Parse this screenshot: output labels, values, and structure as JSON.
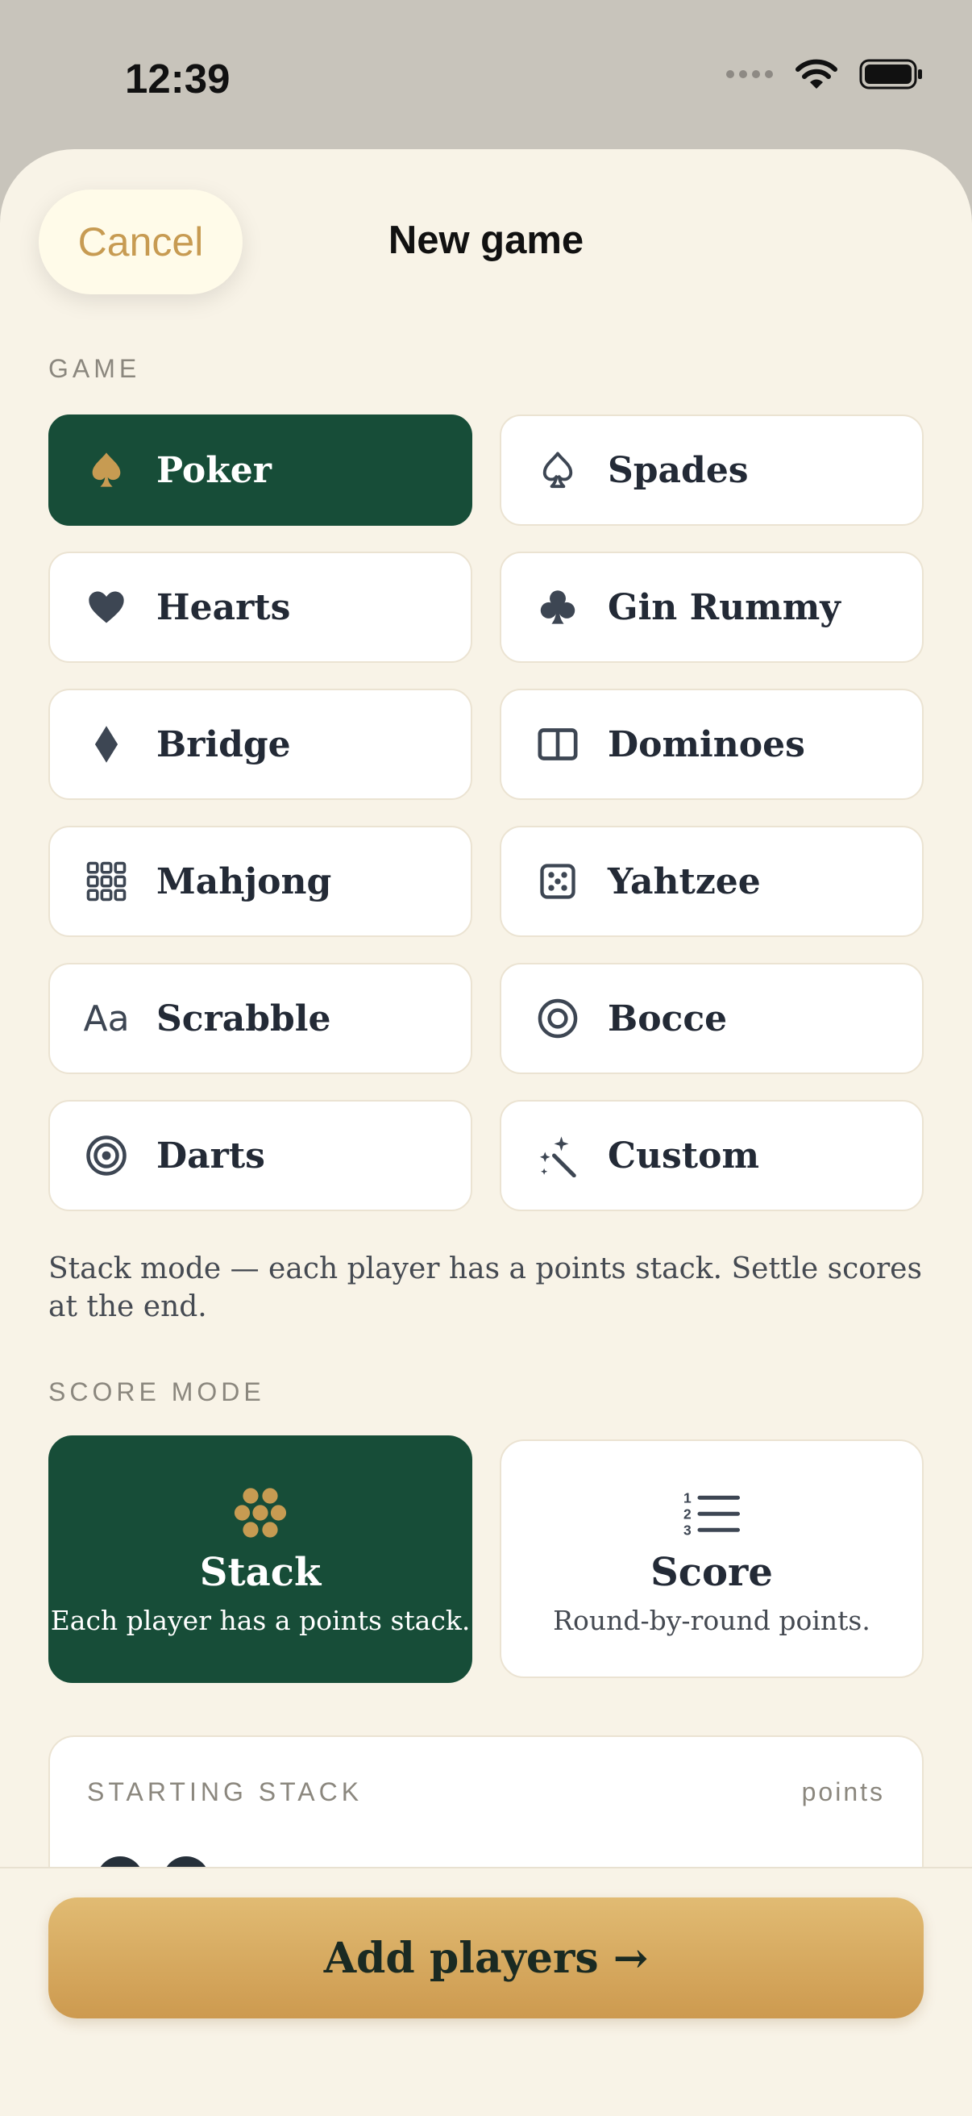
{
  "status": {
    "time": "12:39"
  },
  "header": {
    "cancel_label": "Cancel",
    "title": "New game"
  },
  "game_section": {
    "label": "GAME"
  },
  "games": [
    {
      "label": "Poker",
      "icon": "spade-icon",
      "selected": true
    },
    {
      "label": "Spades",
      "icon": "spade-outline-icon",
      "selected": false
    },
    {
      "label": "Hearts",
      "icon": "heart-icon",
      "selected": false
    },
    {
      "label": "Gin Rummy",
      "icon": "club-icon",
      "selected": false
    },
    {
      "label": "Bridge",
      "icon": "diamond-icon",
      "selected": false
    },
    {
      "label": "Dominoes",
      "icon": "domino-icon",
      "selected": false
    },
    {
      "label": "Mahjong",
      "icon": "grid-icon",
      "selected": false
    },
    {
      "label": "Yahtzee",
      "icon": "dice-icon",
      "selected": false
    },
    {
      "label": "Scrabble",
      "icon": "text-aa-icon",
      "selected": false
    },
    {
      "label": "Bocce",
      "icon": "ring-icon",
      "selected": false
    },
    {
      "label": "Darts",
      "icon": "target-icon",
      "selected": false
    },
    {
      "label": "Custom",
      "icon": "magic-wand-icon",
      "selected": false
    }
  ],
  "game_description": "Stack mode — each player has a points stack. Settle scores at the end.",
  "score_mode": {
    "label": "SCORE MODE",
    "options": [
      {
        "title": "Stack",
        "subtitle": "Each player has a points stack.",
        "icon": "chips-icon",
        "selected": true
      },
      {
        "title": "Score",
        "subtitle": "Round-by-round points.",
        "icon": "numbered-list-icon",
        "selected": false
      }
    ]
  },
  "starting_stack": {
    "label": "STARTING STACK",
    "unit": "points"
  },
  "cta": {
    "label": "Add players →"
  },
  "colors": {
    "accent_green": "#174d38",
    "gold": "#c79b52",
    "background": "#f8f3e7"
  }
}
